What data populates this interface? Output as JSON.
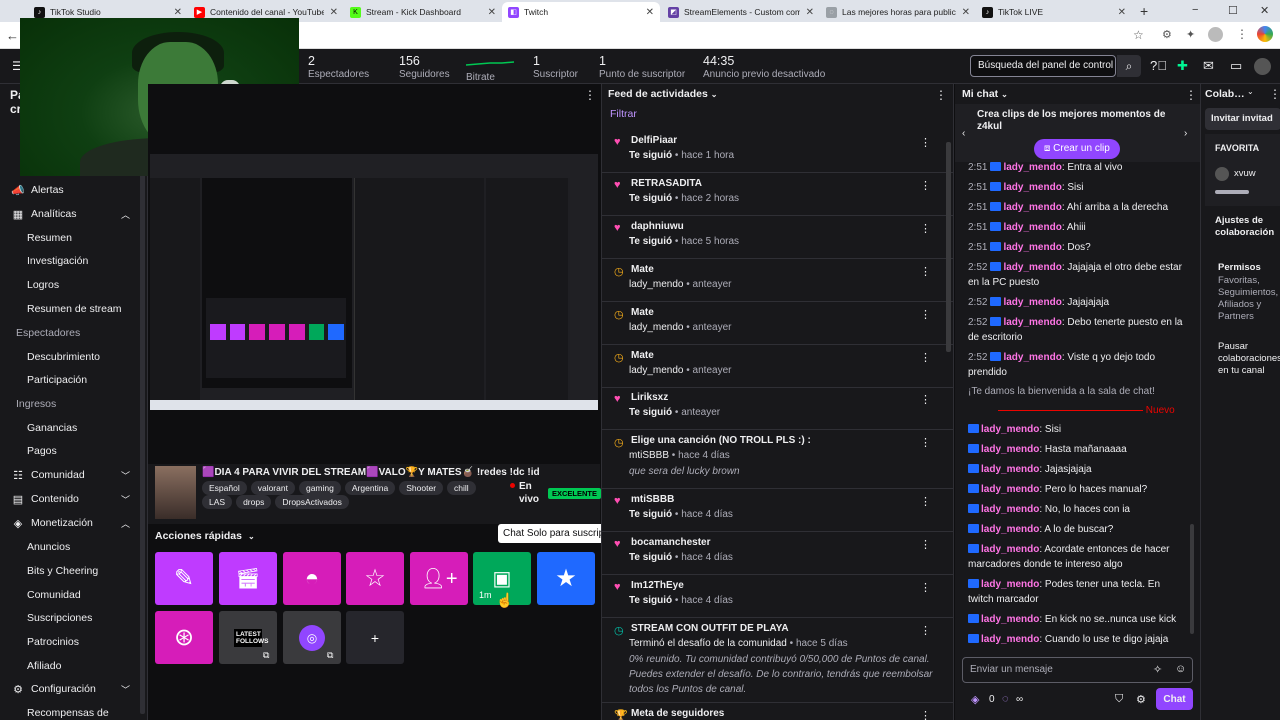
{
  "browser": {
    "tabs": [
      {
        "label": "TikTok Studio",
        "color": "#111111",
        "glyph": "♪"
      },
      {
        "label": "Contenido del canal - YouTube St",
        "color": "#ff0000",
        "glyph": "▶"
      },
      {
        "label": "Stream - Kick Dashboard",
        "color": "#53fc18",
        "glyph": "K"
      },
      {
        "label": "Twitch",
        "color": "#9146ff",
        "glyph": "◧"
      },
      {
        "label": "StreamElements - Custom comm",
        "color": "#6441a5",
        "glyph": "◩"
      },
      {
        "label": "Las mejores horas para publicar e",
        "color": "#9aa0a6",
        "glyph": "◌"
      },
      {
        "label": "TikTok LIVE",
        "color": "#111111",
        "glyph": "♪"
      }
    ],
    "new_tab": "+",
    "minimize": "−",
    "maximize": "☐",
    "close": "✕"
  },
  "topbar": {
    "stats": [
      {
        "value": "2",
        "label": "Espectadores"
      },
      {
        "value": "156",
        "label": "Seguidores"
      },
      {
        "value": "",
        "label": "Bitrate"
      },
      {
        "value": "1",
        "label": "Suscriptor"
      },
      {
        "value": "1",
        "label": "Punto de suscriptor"
      },
      {
        "value": "44:35",
        "label": "Anuncio previo desactivado"
      }
    ],
    "search_placeholder": "Búsqueda del panel de control"
  },
  "sidebar": {
    "header_partial": "Pa",
    "header_partial2": "cr",
    "items": [
      {
        "label": "Alertas",
        "type": "main",
        "icon": "📣"
      },
      {
        "label": "Analíticas",
        "type": "main",
        "icon": "▦",
        "chev": "▲"
      },
      {
        "label": "Resumen",
        "type": "sub"
      },
      {
        "label": "Investigación",
        "type": "sub"
      },
      {
        "label": "Logros",
        "type": "sub"
      },
      {
        "label": "Resumen de stream",
        "type": "sub"
      },
      {
        "label": "Espectadores",
        "type": "grp"
      },
      {
        "label": "Descubrimiento",
        "type": "sub"
      },
      {
        "label": "Participación",
        "type": "sub"
      },
      {
        "label": "Ingresos",
        "type": "grp"
      },
      {
        "label": "Ganancias",
        "type": "sub"
      },
      {
        "label": "Pagos",
        "type": "sub"
      },
      {
        "label": "Comunidad",
        "type": "main",
        "icon": "☷",
        "chev": "▼"
      },
      {
        "label": "Contenido",
        "type": "main",
        "icon": "▤",
        "chev": "▼"
      },
      {
        "label": "Monetización",
        "type": "main",
        "icon": "◈",
        "chev": "▲"
      },
      {
        "label": "Anuncios",
        "type": "sub"
      },
      {
        "label": "Bits y Cheering",
        "type": "sub"
      },
      {
        "label": "Comunidad",
        "type": "sub"
      },
      {
        "label": "Suscripciones",
        "type": "sub"
      },
      {
        "label": "Patrocinios",
        "type": "sub"
      },
      {
        "label": "Afiliado",
        "type": "sub"
      },
      {
        "label": "Configuración",
        "type": "main",
        "icon": "⚙",
        "chev": "▼"
      },
      {
        "label": "Recompensas de",
        "type": "sub"
      }
    ]
  },
  "stream": {
    "title": "🟪DIA 4 PARA VIVIR DEL STREAM🟪VALO🏆Y MATES🧉 !redes !dc !id",
    "tags": [
      "Español",
      "valorant",
      "gaming",
      "Argentina",
      "Shooter",
      "chill",
      "LAS",
      "drops",
      "DropsActivados"
    ],
    "live_label": "En vivo",
    "health": "EXCELENTE"
  },
  "quick_actions": {
    "title": "Acciones rápidas",
    "tooltip": "Chat Solo para suscriptores",
    "timer": "1m",
    "latest_follows_label": "LATEST FOLLOWS",
    "add": "+"
  },
  "feed": {
    "title": "Feed de actividades",
    "filter": "Filtrar",
    "items": [
      {
        "icon": "♥",
        "icon_color": "#ff4eb3",
        "name": "DelfiPiaar",
        "action": "Te siguió",
        "time": "hace 1 hora"
      },
      {
        "icon": "♥",
        "icon_color": "#ff4eb3",
        "name": "RETRASADITA",
        "action": "Te siguió",
        "time": "hace 2 horas"
      },
      {
        "icon": "♥",
        "icon_color": "#ff4eb3",
        "name": "daphniuwu",
        "action": "Te siguió",
        "time": "hace 5 horas"
      },
      {
        "icon": "◷",
        "icon_color": "#ffb31a",
        "name": "Mate",
        "action": "lady_mendo",
        "time": "anteayer"
      },
      {
        "icon": "◷",
        "icon_color": "#ffb31a",
        "name": "Mate",
        "action": "lady_mendo",
        "time": "anteayer"
      },
      {
        "icon": "◷",
        "icon_color": "#ffb31a",
        "name": "Mate",
        "action": "lady_mendo",
        "time": "anteayer"
      },
      {
        "icon": "♥",
        "icon_color": "#ff4eb3",
        "name": "Liriksxz",
        "action": "Te siguió",
        "time": "anteayer"
      },
      {
        "icon": "◷",
        "icon_color": "#ffb31a",
        "name": "Elige una canción (NO TROLL PLS :) :",
        "action": "mtiSBBB",
        "time": "hace 4 días",
        "extra": "que sera del lucky brown"
      },
      {
        "icon": "♥",
        "icon_color": "#ff4eb3",
        "name": "mtiSBBB",
        "action": "Te siguió",
        "time": "hace 4 días"
      },
      {
        "icon": "♥",
        "icon_color": "#ff4eb3",
        "name": "bocamanchester",
        "action": "Te siguió",
        "time": "hace 4 días"
      },
      {
        "icon": "♥",
        "icon_color": "#ff4eb3",
        "name": "Im12ThEye",
        "action": "Te siguió",
        "time": "hace 4 días"
      },
      {
        "icon": "◷",
        "icon_color": "#00c8af",
        "name": "STREAM CON OUTFIT DE PLAYA",
        "action": "Terminó el desafío de la comunidad",
        "time": "hace 5 días",
        "extra": "0% reunido. Tu comunidad contribuyó 0/50,000 de Puntos de canal.",
        "extra2": "Puedes extender el desafío. De lo contrario, tendrás que reembolsar",
        "extra3": "todos los Puntos de canal."
      },
      {
        "icon": "🏆",
        "icon_color": "#00c8af",
        "name": "Meta de seguidores",
        "action": "",
        "time": ""
      }
    ]
  },
  "chat": {
    "title": "Mi chat",
    "clip_text": "Crea clips de los mejores momentos de z4kul",
    "clip_button": "Crear un clip",
    "messages_top": [
      {
        "time": "2:51",
        "user": "lady_mendo",
        "text": "Entra al vivo"
      },
      {
        "time": "2:51",
        "user": "lady_mendo",
        "text": "Sisi"
      },
      {
        "time": "2:51",
        "user": "lady_mendo",
        "text": "Ahí arriba a la derecha"
      },
      {
        "time": "2:51",
        "user": "lady_mendo",
        "text": "Ahiii"
      },
      {
        "time": "2:51",
        "user": "lady_mendo",
        "text": "Dos?"
      },
      {
        "time": "2:52",
        "user": "lady_mendo",
        "text": "Jajajaja el otro debe estar en la PC puesto"
      },
      {
        "time": "2:52",
        "user": "lady_mendo",
        "text": "Jajajajaja"
      },
      {
        "time": "2:52",
        "user": "lady_mendo",
        "text": "Debo tenerte puesto en la de escritorio"
      },
      {
        "time": "2:52",
        "user": "lady_mendo",
        "text": "Viste q yo dejo todo prendido"
      }
    ],
    "welcome": "¡Te damos la bienvenida a la sala de chat!",
    "new_label": "Nuevo",
    "messages_bottom": [
      {
        "user": "lady_mendo",
        "text": "Sisi"
      },
      {
        "user": "lady_mendo",
        "text": "Hasta mañanaaaa"
      },
      {
        "user": "lady_mendo",
        "text": "Jajasjajaja"
      },
      {
        "user": "lady_mendo",
        "text": "Pero lo haces manual?"
      },
      {
        "user": "lady_mendo",
        "text": "No, lo haces con ia"
      },
      {
        "user": "lady_mendo",
        "text": "A lo de buscar?"
      },
      {
        "user": "lady_mendo",
        "text": "Acordate entonces de hacer marcadores donde te intereso algo"
      },
      {
        "user": "lady_mendo",
        "text": "Podes tener una tecla. En twitch marcador"
      },
      {
        "user": "lady_mendo",
        "text": "En kick no se..nunca use kick"
      },
      {
        "user": "lady_mendo",
        "text": "Cuando lo use te digo jajaja"
      }
    ],
    "input_placeholder": "Enviar un mensaje",
    "points": "0",
    "infinity": "∞",
    "send": "Chat"
  },
  "collab": {
    "title": "Colab…",
    "invite": "Invitar invitad",
    "favorites": "FAVORITA",
    "fav_user": "xvuw",
    "settings_title": "Ajustes de colaboración",
    "permisos_title": "Permisos",
    "permisos_desc": "Favoritas, Seguimientos, Afiliados y Partners",
    "pause_title": "Pausar colaboraciones en tu canal"
  },
  "colors": {
    "accent": "#9146ff",
    "feed_accent": "#bf94ff",
    "username": "#ff75e6",
    "health": "#00c853"
  }
}
